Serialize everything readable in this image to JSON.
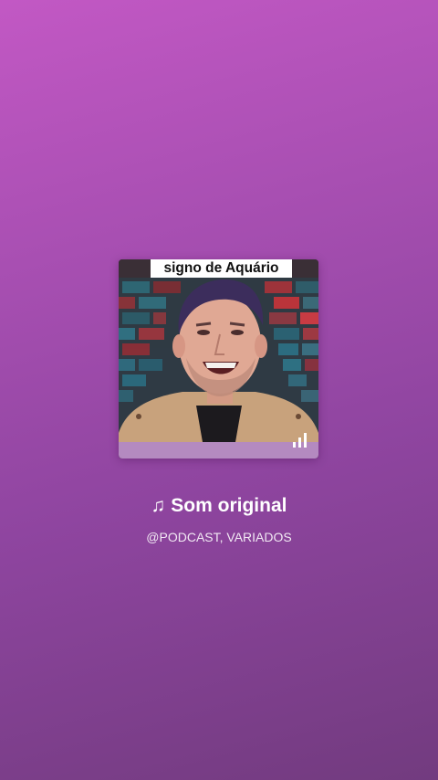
{
  "card": {
    "caption": "signo de Aquário",
    "art_icon": "video-thumbnail-portrait",
    "playing_icon": "audio-bars-icon"
  },
  "sound": {
    "note_icon": "♫",
    "title": "Som original",
    "author": "@PODCAST, VARIADOS"
  },
  "colors": {
    "background_top": "#c258c4",
    "background_bottom": "#723b7f",
    "caption_bg": "#ffffff",
    "text": "#ffffff"
  }
}
